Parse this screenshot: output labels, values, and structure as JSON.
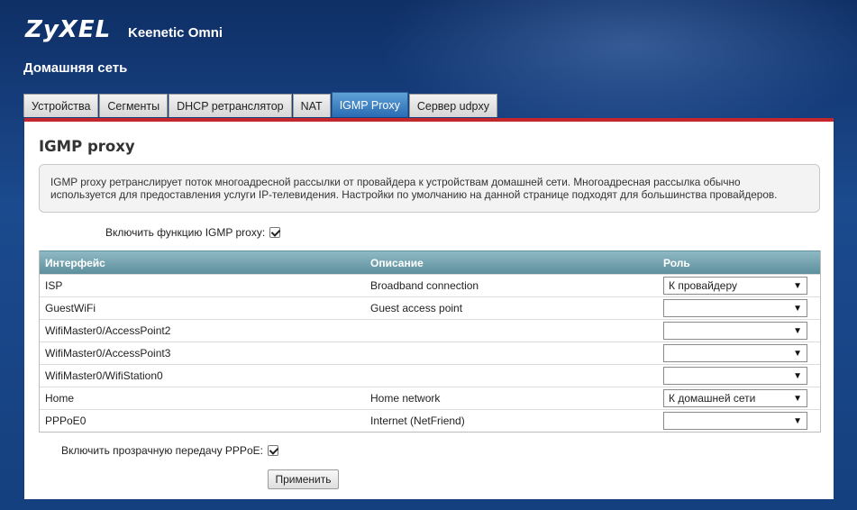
{
  "header": {
    "logo": "ZyXEL",
    "product": "Keenetic Omni",
    "section": "Домашняя сеть"
  },
  "tabs": [
    {
      "label": "Устройства",
      "active": false
    },
    {
      "label": "Сегменты",
      "active": false
    },
    {
      "label": "DHCP ретранслятор",
      "active": false
    },
    {
      "label": "NAT",
      "active": false
    },
    {
      "label": "IGMP Proxy",
      "active": true
    },
    {
      "label": "Сервер udpxy",
      "active": false
    }
  ],
  "panel": {
    "title": "IGMP proxy",
    "info_line1": "IGMP proxy ретранслирует поток многоадресной рассылки от провайдера к устройствам домашней сети. Многоадресная рассылка обычно",
    "info_line2": "используется для предоставления услуги IP-телевидения. Настройки по умолчанию на данной странице подходят для большинства провайдеров.",
    "enable_label": "Включить функцию IGMP proxy:",
    "enable_checked": true,
    "pppoe_label": "Включить прозрачную передачу PPPoE:",
    "pppoe_checked": true,
    "apply_label": "Применить"
  },
  "table": {
    "headers": {
      "interface": "Интерфейс",
      "description": "Описание",
      "role": "Роль"
    },
    "rows": [
      {
        "interface": "ISP",
        "description": "Broadband connection",
        "role": "К провайдеру"
      },
      {
        "interface": "GuestWiFi",
        "description": "Guest access point",
        "role": ""
      },
      {
        "interface": "WifiMaster0/AccessPoint2",
        "description": "",
        "role": ""
      },
      {
        "interface": "WifiMaster0/AccessPoint3",
        "description": "",
        "role": ""
      },
      {
        "interface": "WifiMaster0/WifiStation0",
        "description": "",
        "role": ""
      },
      {
        "interface": "Home",
        "description": "Home network",
        "role": "К домашней сети"
      },
      {
        "interface": "PPPoE0",
        "description": "Internet (NetFriend)",
        "role": ""
      }
    ]
  },
  "icons": {
    "dropdown": "chevron-down-icon",
    "check": "check-icon"
  }
}
